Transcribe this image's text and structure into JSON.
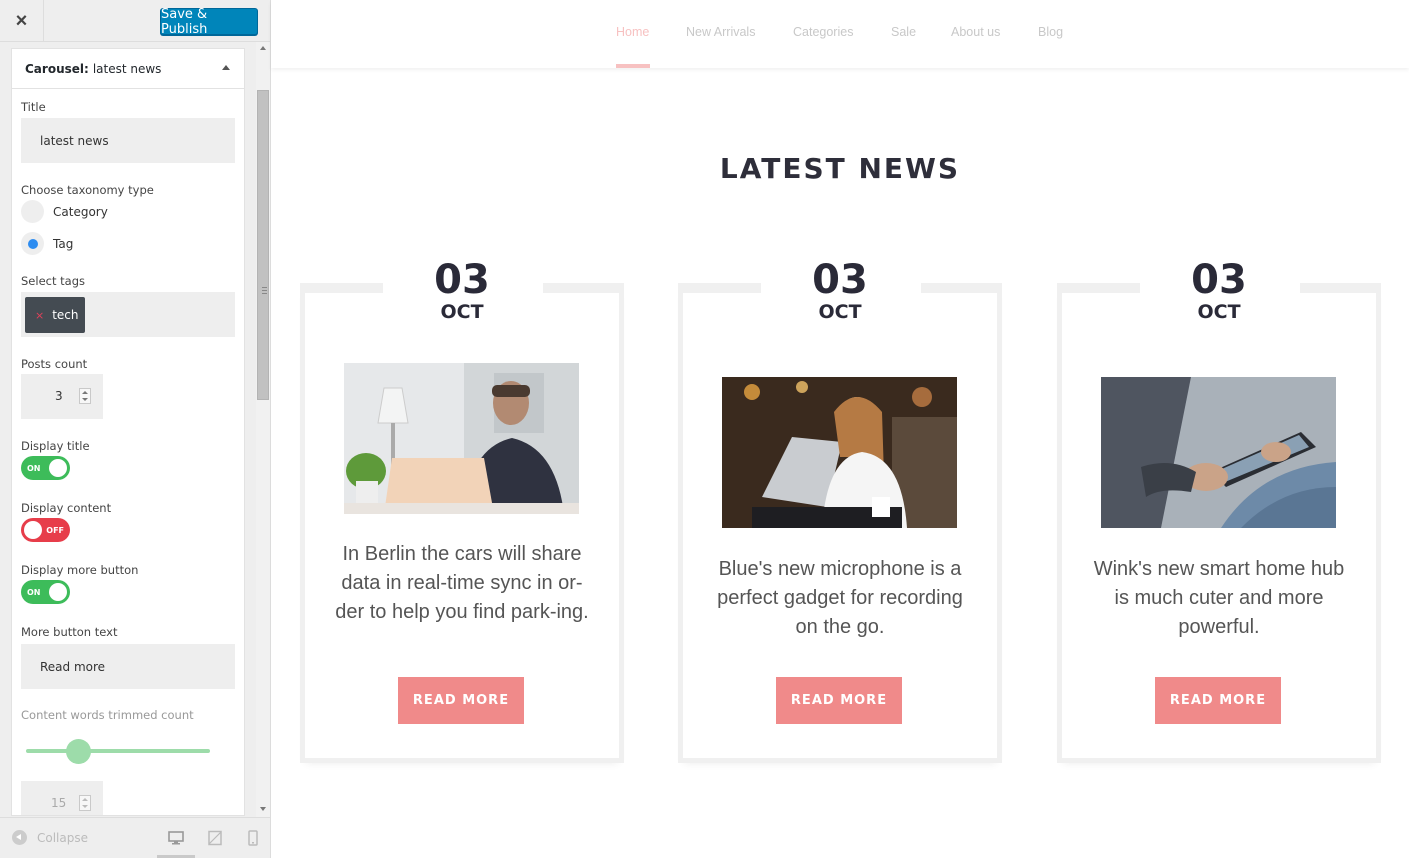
{
  "customizer": {
    "close_label": "×",
    "save_label": "Save & Publish",
    "panel_title_bold": "Carousel:",
    "panel_title": "latest news",
    "title_label": "Title",
    "title_value": "latest news",
    "taxonomy_label": "Choose taxonomy type",
    "taxonomy_options": [
      "Category",
      "Tag"
    ],
    "taxonomy_selected": "Tag",
    "tags_label": "Select tags",
    "tag_remove": "×",
    "tags": [
      "tech"
    ],
    "posts_count_label": "Posts count",
    "posts_count": "3",
    "display_title_label": "Display title",
    "display_title": "ON",
    "display_content_label": "Display content",
    "display_content": "OFF",
    "display_more_label": "Display more button",
    "display_more": "ON",
    "more_text_label": "More button text",
    "more_text_value": "Read more",
    "trim_label": "Content words trimmed count",
    "trim_value": "15",
    "collapse_label": "Collapse",
    "devices": [
      "desktop-icon",
      "tablet-icon",
      "mobile-icon"
    ]
  },
  "site": {
    "nav": [
      "Home",
      "New Arrivals",
      "Categories",
      "Sale",
      "About us",
      "Blog"
    ],
    "active_nav": "Home",
    "section_title": "LATEST NEWS",
    "accent_color": "#f08a8a",
    "posts": [
      {
        "day": "03",
        "month": "OCT",
        "text": "In Berlin the cars will share data in real-time sync in or-der to help you find park-ing.",
        "button": "READ MORE"
      },
      {
        "day": "03",
        "month": "OCT",
        "text": "Blue's new microphone is a perfect gadget for recording on the go.",
        "button": "READ MORE"
      },
      {
        "day": "03",
        "month": "OCT",
        "text": "Wink's new smart home hub is much cuter and more powerful.",
        "button": "READ MORE"
      }
    ]
  }
}
